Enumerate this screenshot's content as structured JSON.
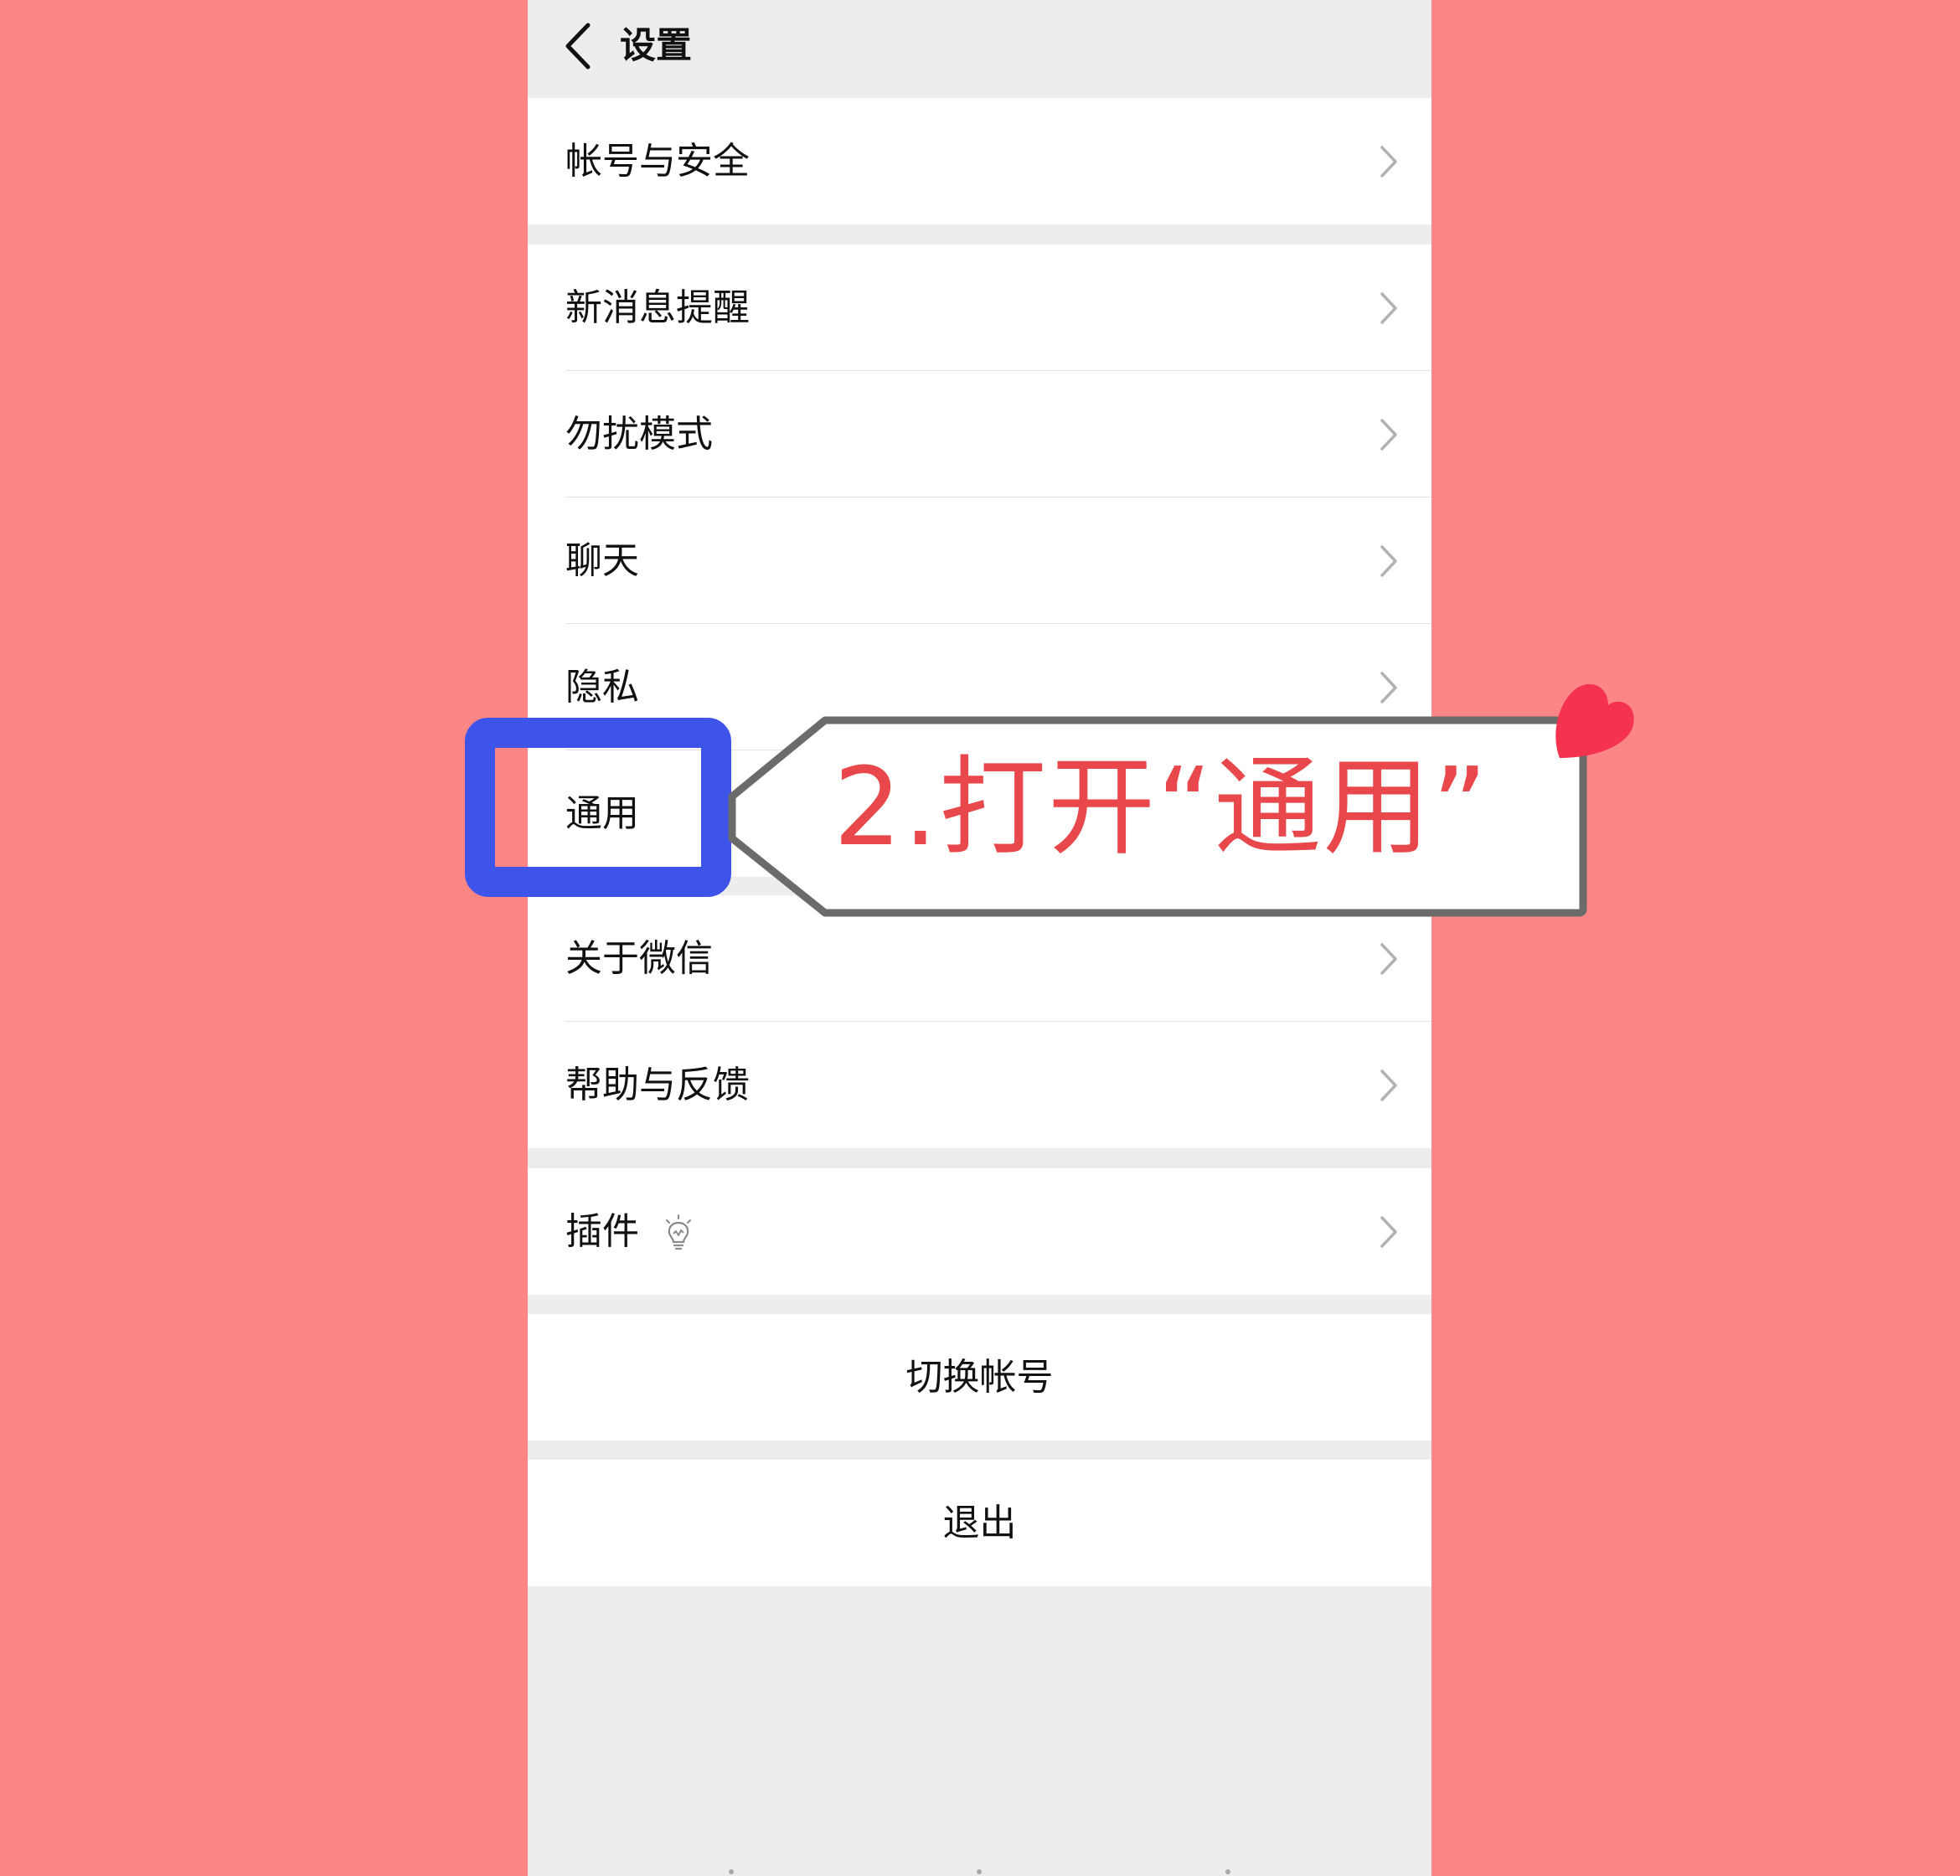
{
  "header": {
    "back_icon": "chevron-left-icon",
    "title": "设置"
  },
  "groups": [
    {
      "items": [
        {
          "label": "帐号与安全",
          "icon": "chevron-right-icon"
        }
      ]
    },
    {
      "items": [
        {
          "label": "新消息提醒",
          "icon": "chevron-right-icon"
        },
        {
          "label": "勿扰模式",
          "icon": "chevron-right-icon"
        },
        {
          "label": "聊天",
          "icon": "chevron-right-icon"
        },
        {
          "label": "隐私",
          "icon": "chevron-right-icon"
        },
        {
          "label": "通用",
          "icon": "chevron-right-icon"
        }
      ]
    },
    {
      "items": [
        {
          "label": "关于微信",
          "icon": "chevron-right-icon"
        },
        {
          "label": "帮助与反馈",
          "icon": "chevron-right-icon"
        }
      ]
    },
    {
      "items": [
        {
          "label": "插件",
          "badge_icon": "lightbulb-icon",
          "icon": "chevron-right-icon"
        }
      ]
    }
  ],
  "actions": {
    "switch_account": "切换帐号",
    "logout": "退出"
  },
  "annotation": {
    "callout_text": "2.打开“通用”",
    "highlight_color": "#3e54e8",
    "text_color": "#e8474b",
    "heart_color": "#f5334f"
  },
  "colors": {
    "background": "#fc8686",
    "screen_bg": "#ededed",
    "row_bg": "#ffffff"
  }
}
